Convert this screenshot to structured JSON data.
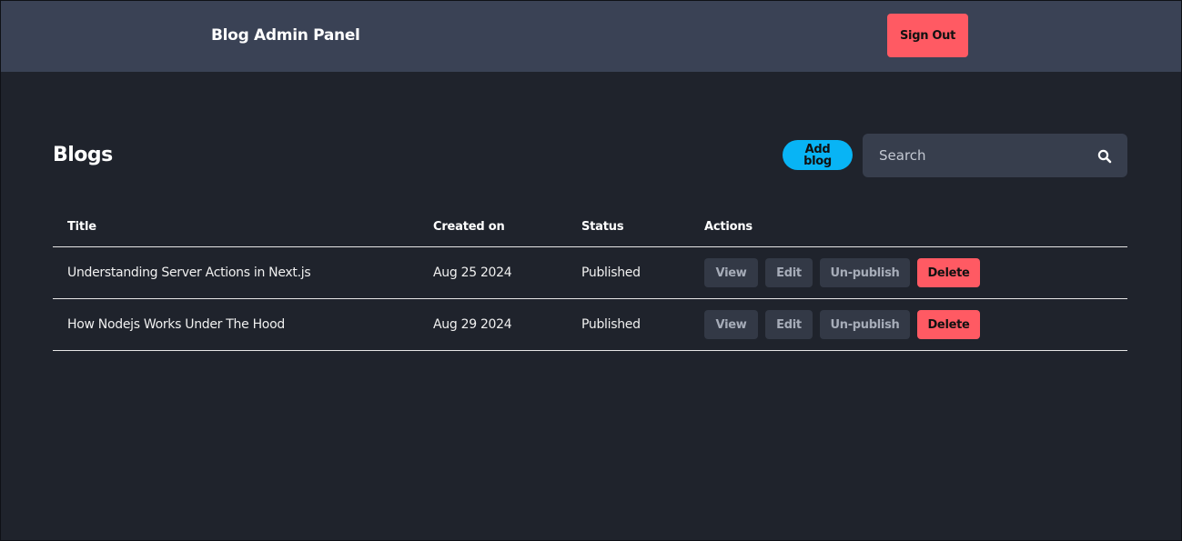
{
  "header": {
    "app_title": "Blog Admin Panel",
    "sign_out_label": "Sign Out"
  },
  "main": {
    "page_title": "Blogs",
    "add_blog_label": "Add blog",
    "search": {
      "placeholder": "Search",
      "value": ""
    }
  },
  "table": {
    "columns": [
      "Title",
      "Created on",
      "Status",
      "Actions"
    ],
    "rows": [
      {
        "title": "Understanding Server Actions in Next.js",
        "created_on": "Aug 25 2024",
        "status": "Published",
        "actions": [
          "View",
          "Edit",
          "Un-publish",
          "Delete"
        ]
      },
      {
        "title": "How Nodejs Works Under The Hood",
        "created_on": "Aug 29 2024",
        "status": "Published",
        "actions": [
          "View",
          "Edit",
          "Un-publish",
          "Delete"
        ]
      }
    ]
  },
  "colors": {
    "background": "#1f232c",
    "navbar": "#3a4255",
    "danger": "#ff5a63",
    "accent": "#08b4f5",
    "secondary_button": "#333946"
  },
  "icons": {
    "search": "search-icon"
  }
}
